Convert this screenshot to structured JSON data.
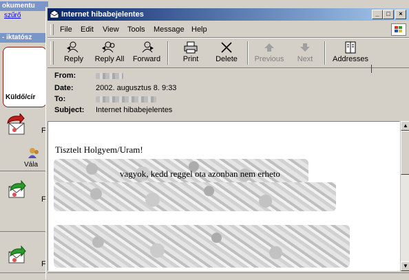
{
  "background_app": {
    "title1": "okumentu",
    "sublink": "szűrő",
    "title2": "- iktatósz",
    "panel_label": "Küldő/cír",
    "letter": "F",
    "valasz_label": "Vála"
  },
  "window": {
    "title": "Internet hibabejelentes",
    "controls": {
      "minimize": "_",
      "maximize": "□",
      "close": "×"
    }
  },
  "menu": [
    "File",
    "Edit",
    "View",
    "Tools",
    "Message",
    "Help"
  ],
  "toolbar": {
    "reply": "Reply",
    "reply_all": "Reply All",
    "forward": "Forward",
    "print": "Print",
    "delete": "Delete",
    "previous": "Previous",
    "next": "Next",
    "addresses": "Addresses"
  },
  "header": {
    "from_label": "From:",
    "date_label": "Date:",
    "date_value": "2002. augusztus 8. 9:33",
    "to_label": "To:",
    "subject_label": "Subject:",
    "subject_value": "Internet hibabejelentes"
  },
  "body": {
    "greeting": "Tisztelt Holgyem/Uram!",
    "line2": "vagyok, kedd reggel ota azonban nem erheto"
  },
  "scrollbar": {
    "up": "▲",
    "down": "▼"
  },
  "colors": {
    "titlebar_start": "#0a246a",
    "titlebar_end": "#a6caf0",
    "face": "#d4d0c8",
    "panel_border": "#8b1c1c"
  }
}
